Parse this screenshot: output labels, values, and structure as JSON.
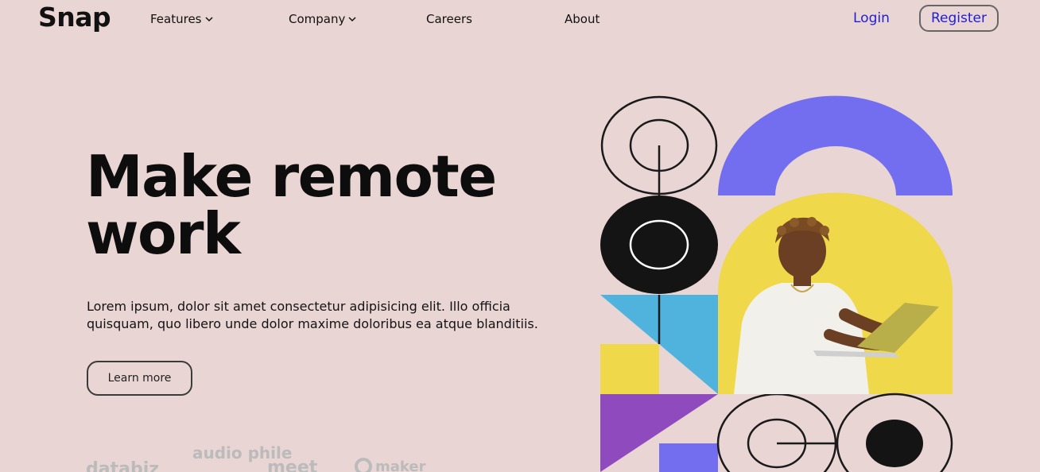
{
  "header": {
    "brand": "Snap",
    "nav": [
      {
        "label": "Features",
        "has_dropdown": true
      },
      {
        "label": "Company",
        "has_dropdown": true
      },
      {
        "label": "Careers",
        "has_dropdown": false
      },
      {
        "label": "About",
        "has_dropdown": false
      }
    ],
    "login_label": "Login",
    "register_label": "Register"
  },
  "hero": {
    "title": "Make remote\nwork",
    "body": "Lorem ipsum, dolor sit amet consectetur adipisicing elit. Illo officia quisquam, quo libero unde dolor maxime doloribus ea atque blanditiis.",
    "cta_label": "Learn more"
  },
  "logos": [
    {
      "name": "databiz",
      "label": "databiz"
    },
    {
      "name": "audiophile",
      "label": "audio phile"
    },
    {
      "name": "meet",
      "label": "meet"
    },
    {
      "name": "maker",
      "label": "maker"
    }
  ],
  "colors": {
    "background": "#e9d5d4",
    "accent_purple": "#736ef0",
    "accent_yellow": "#efd94a",
    "accent_blue": "#4fb3de",
    "accent_violet": "#8f4bbd",
    "link_blue": "#1f1fcf"
  }
}
